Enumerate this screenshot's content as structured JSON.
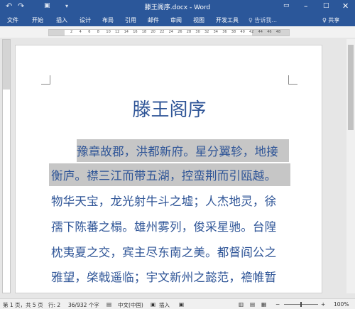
{
  "window": {
    "title": "滕王阁序.docx - Word"
  },
  "quick_access": {
    "undo_icon": "undo-icon",
    "redo_icon": "redo-icon",
    "save_icon": "save-icon",
    "customize_icon": "chevron-down-icon"
  },
  "ribbon": {
    "tabs": [
      "文件",
      "开始",
      "插入",
      "设计",
      "布局",
      "引用",
      "邮件",
      "审阅",
      "视图",
      "开发工具"
    ],
    "tell_me": "♀ 告诉我...",
    "share": "♀ 共享"
  },
  "ruler": {
    "marks": [
      "2",
      "4",
      "6",
      "8",
      "10",
      "12",
      "14",
      "16",
      "18",
      "20",
      "22",
      "24",
      "26",
      "28",
      "30",
      "32",
      "34",
      "36",
      "38",
      "40",
      "42",
      "44",
      "46",
      "48"
    ]
  },
  "document": {
    "title": "滕王阁序",
    "lines": [
      "豫章故郡，洪都新府。星分翼轸，地接",
      "衡庐。襟三江而带五湖，控蛮荆而引瓯越。",
      "物华天宝，龙光射牛斗之墟；人杰地灵，徐",
      "孺下陈蕃之榻。雄州雾列，俊采星驰。台隍",
      "枕夷夏之交，宾主尽东南之美。都督阎公之",
      "雅望，棨戟遥临；宇文新州之懿范，襜帷暂"
    ]
  },
  "status_bar": {
    "page": "第 1 页，共 5 页",
    "line": "行: 2",
    "words": "36/932 个字",
    "language": "中文(中国)",
    "mode": "插入",
    "zoom": "100%",
    "zoom_minus": "−",
    "zoom_plus": "+"
  }
}
